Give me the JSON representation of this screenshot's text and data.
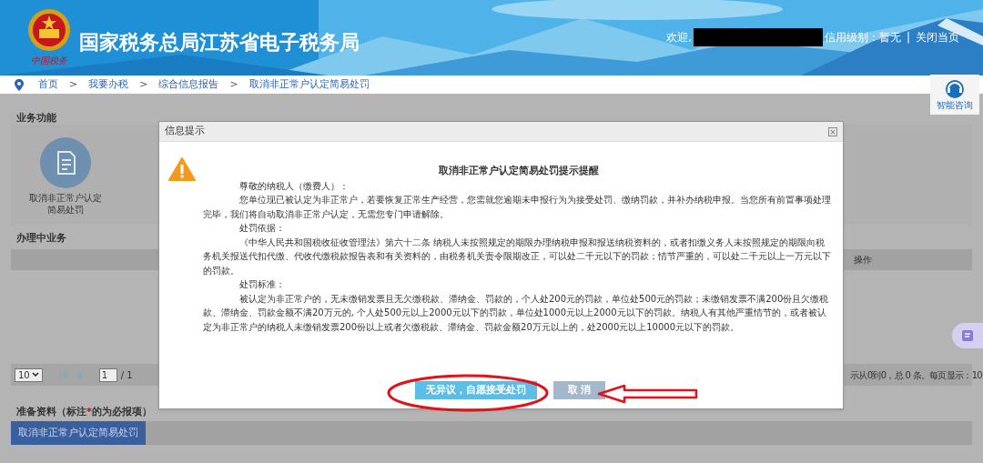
{
  "header": {
    "title": "国家税务总局江苏省电子税务局",
    "logo_caption": "中国税务",
    "welcome": "欢迎,",
    "credit": "信用级别：暂无",
    "separator": "|",
    "close": "关闭当页"
  },
  "breadcrumb": [
    "首页",
    "我要办税",
    "综合信息报告",
    "取消非正常户认定简易处罚"
  ],
  "breadcrumb_separator": ">",
  "assistant": {
    "label": "智能咨询"
  },
  "business_functions": {
    "title": "业务功能",
    "items": [
      {
        "label": "取消非正常户认定简易处罚"
      }
    ]
  },
  "in_progress": {
    "title": "办理中业务",
    "columns": [
      "操作"
    ],
    "pager": {
      "page_size": "10",
      "page": "1",
      "total_pages": "/ 1",
      "summary": "示从0到0，总 0 条。每页显示：10"
    }
  },
  "materials": {
    "title_before": "准备资料（标注",
    "required_mark": "*",
    "title_after": "的为必报项）",
    "tabs": [
      {
        "label": "取消非正常户认定简易处罚",
        "selected": true
      }
    ]
  },
  "dialog": {
    "title": "信息提示",
    "close": "×",
    "heading": "取消非正常户认定简易处罚提示提醒",
    "paragraphs": [
      {
        "kind": "body",
        "text": "尊敬的纳税人（缴费人）："
      },
      {
        "kind": "body",
        "text": "您单位现已被认定为非正常户，若要恢复正常生产经营，您需就您逾期未申报行为为接受处罚、缴纳罚款，并补办纳税申报。当您所有前置事项处理完毕，我们将自动取消非正常户认定，无需您专门申请解除。"
      },
      {
        "kind": "body",
        "text": "处罚依据："
      },
      {
        "kind": "body",
        "text": "《中华人民共和国税收征收管理法》第六十二条 纳税人未按照规定的期限办理纳税申报和报送纳税资料的，或者扣缴义务人未按照规定的期限向税务机关报送代扣代缴、代收代缴税款报告表和有关资料的，由税务机关责令限期改正，可以处二千元以下的罚款；情节严重的，可以处二千元以上一万元以下的罚款。"
      },
      {
        "kind": "body",
        "text": "处罚标准："
      },
      {
        "kind": "body",
        "text": "被认定为非正常户的，无未缴销发票且无欠缴税款、滞纳金、罚款的，个人处200元的罚款，单位处500元的罚款；未缴销发票不满200份且欠缴税款、滞纳金、罚款金额不满20万元的, 个人处500元以上2000元以下的罚款，单位处1000元以上2000元以下的罚款。纳税人有其他严重情节的，或者被认定为非正常户的纳税人未缴销发票200份以上或者欠缴税款、滞纳金、罚款金额20万元以上的，处2000元以上10000元以下的罚款。"
      }
    ],
    "buttons": [
      {
        "kind": "primary",
        "label": "无异议，自愿接受处罚"
      },
      {
        "kind": "secondary",
        "label": "取 消"
      }
    ]
  }
}
